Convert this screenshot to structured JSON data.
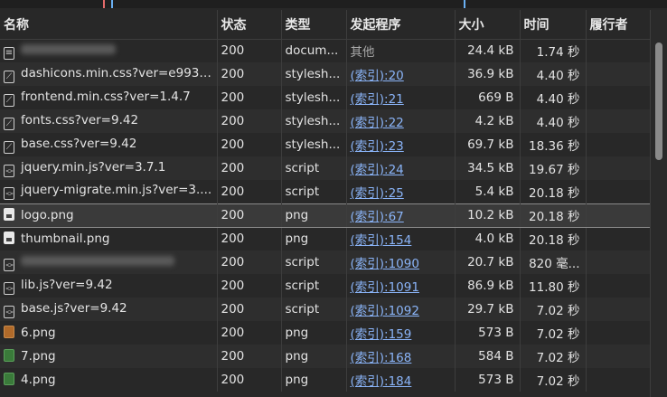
{
  "columns": {
    "name": "名称",
    "status": "状态",
    "type": "类型",
    "initiator": "发起程序",
    "size": "大小",
    "time": "时间",
    "fulfilled_by": "履行者"
  },
  "rows": [
    {
      "icon": "document-icon",
      "name": "",
      "status": "200",
      "type": "docum...",
      "initiator": "其他",
      "initiator_link": false,
      "size": "24.4 kB",
      "time": "1.74 秒"
    },
    {
      "icon": "stylesheet-icon",
      "name": "dashicons.min.css?ver=e9932...",
      "status": "200",
      "type": "stylesh...",
      "initiator": "(索引):20",
      "initiator_link": true,
      "size": "36.9 kB",
      "time": "4.40 秒"
    },
    {
      "icon": "stylesheet-icon",
      "name": "frontend.min.css?ver=1.4.7",
      "status": "200",
      "type": "stylesh...",
      "initiator": "(索引):21",
      "initiator_link": true,
      "size": "669 B",
      "time": "4.40 秒"
    },
    {
      "icon": "stylesheet-icon",
      "name": "fonts.css?ver=9.42",
      "status": "200",
      "type": "stylesh...",
      "initiator": "(索引):22",
      "initiator_link": true,
      "size": "4.2 kB",
      "time": "4.40 秒"
    },
    {
      "icon": "stylesheet-icon",
      "name": "base.css?ver=9.42",
      "status": "200",
      "type": "stylesh...",
      "initiator": "(索引):23",
      "initiator_link": true,
      "size": "69.7 kB",
      "time": "18.36 秒"
    },
    {
      "icon": "script-icon",
      "name": "jquery.min.js?ver=3.7.1",
      "status": "200",
      "type": "script",
      "initiator": "(索引):24",
      "initiator_link": true,
      "size": "34.5 kB",
      "time": "19.67 秒"
    },
    {
      "icon": "script-icon",
      "name": "jquery-migrate.min.js?ver=3....",
      "status": "200",
      "type": "script",
      "initiator": "(索引):25",
      "initiator_link": true,
      "size": "5.4 kB",
      "time": "20.18 秒"
    },
    {
      "icon": "image-icon",
      "name": "logo.png",
      "status": "200",
      "type": "png",
      "initiator": "(索引):67",
      "initiator_link": true,
      "size": "10.2 kB",
      "time": "20.18 秒",
      "selected": true
    },
    {
      "icon": "image-icon",
      "name": "thumbnail.png",
      "status": "200",
      "type": "png",
      "initiator": "(索引):154",
      "initiator_link": true,
      "size": "4.0 kB",
      "time": "20.18 秒"
    },
    {
      "icon": "script-icon",
      "name": "",
      "status": "200",
      "type": "script",
      "initiator": "(索引):1090",
      "initiator_link": true,
      "size": "20.7 kB",
      "time": "820 毫..."
    },
    {
      "icon": "script-icon",
      "name": "lib.js?ver=9.42",
      "status": "200",
      "type": "script",
      "initiator": "(索引):1091",
      "initiator_link": true,
      "size": "86.9 kB",
      "time": "11.80 秒"
    },
    {
      "icon": "script-icon",
      "name": "base.js?ver=9.42",
      "status": "200",
      "type": "script",
      "initiator": "(索引):1092",
      "initiator_link": true,
      "size": "29.7 kB",
      "time": "7.02 秒"
    },
    {
      "icon": "image-brown-icon",
      "name": "6.png",
      "status": "200",
      "type": "png",
      "initiator": "(索引):159",
      "initiator_link": true,
      "size": "573 B",
      "time": "7.02 秒"
    },
    {
      "icon": "image-green-icon",
      "name": "7.png",
      "status": "200",
      "type": "png",
      "initiator": "(索引):168",
      "initiator_link": true,
      "size": "584 B",
      "time": "7.02 秒"
    },
    {
      "icon": "image-green-icon",
      "name": "4.png",
      "status": "200",
      "type": "png",
      "initiator": "(索引):184",
      "initiator_link": true,
      "size": "573 B",
      "time": "7.02 秒"
    }
  ]
}
